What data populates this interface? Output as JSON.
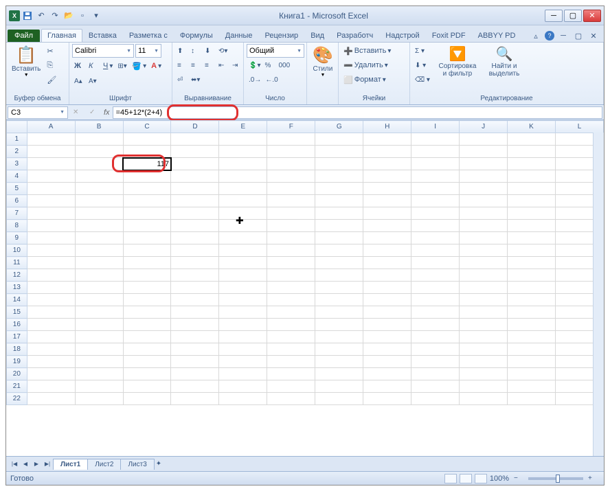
{
  "title": "Книга1 - Microsoft Excel",
  "tabs": {
    "file": "Файл",
    "list": [
      "Главная",
      "Вставка",
      "Разметка с",
      "Формулы",
      "Данные",
      "Рецензир",
      "Вид",
      "Разработч",
      "Надстрой",
      "Foxit PDF",
      "ABBYY PD"
    ],
    "active": 0
  },
  "ribbon": {
    "clipboard": {
      "paste": "Вставить",
      "label": "Буфер обмена"
    },
    "font": {
      "name": "Calibri",
      "size": "11",
      "label": "Шрифт"
    },
    "align": {
      "label": "Выравнивание"
    },
    "number": {
      "format": "Общий",
      "label": "Число"
    },
    "styles": {
      "btn": "Стили",
      "label": ""
    },
    "cells": {
      "insert": "Вставить",
      "delete": "Удалить",
      "format": "Формат",
      "label": "Ячейки"
    },
    "editing": {
      "sort": "Сортировка и фильтр",
      "find": "Найти и выделить",
      "label": "Редактирование"
    }
  },
  "nameBox": "C3",
  "formula": "=45+12*(2+4)",
  "columns": [
    "A",
    "B",
    "C",
    "D",
    "E",
    "F",
    "G",
    "H",
    "I",
    "J",
    "K",
    "L"
  ],
  "rows": 22,
  "selectedCell": {
    "row": 3,
    "col": "C",
    "value": "117"
  },
  "sheets": [
    "Лист1",
    "Лист2",
    "Лист3"
  ],
  "activeSheet": 0,
  "status": "Готово",
  "zoom": "100%"
}
